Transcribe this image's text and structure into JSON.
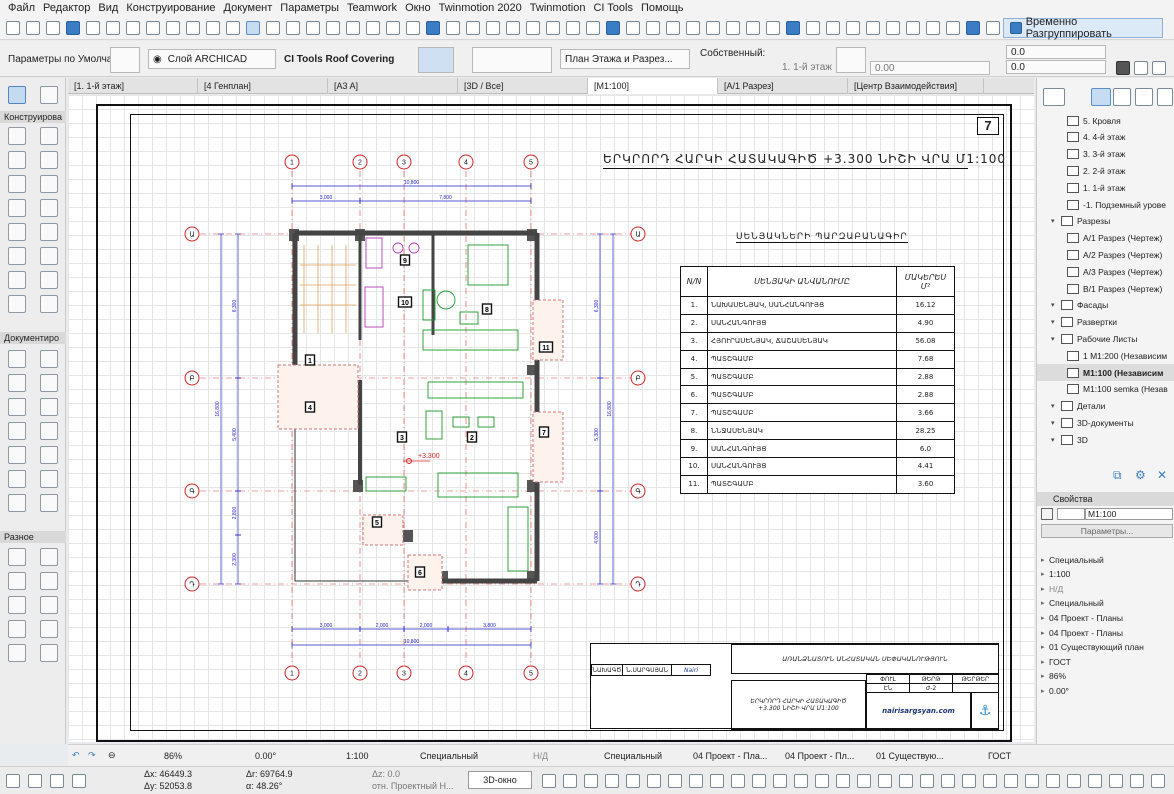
{
  "menu": [
    "Файл",
    "Редактор",
    "Вид",
    "Конструирование",
    "Документ",
    "Параметры",
    "Teamwork",
    "Окно",
    "Twinmotion 2020",
    "Twinmotion",
    "CI Tools",
    "Помощь"
  ],
  "toolbar": {
    "regroup_label": "Временно Разгруппировать"
  },
  "infobox": {
    "defaults": "Параметры по Умолчанию",
    "layer": "Слой ARCHICAD",
    "tool_name": "CI Tools Roof Covering",
    "view_mode": "План Этажа и Разрез...",
    "own_label": "Собственный:",
    "floor": "1. 1-й этаж",
    "val1": "0.0",
    "val2": "0.0",
    "val3": "0.00"
  },
  "tabs": [
    {
      "label": "[1. 1-й этаж]",
      "active": false
    },
    {
      "label": "[4 Генплан]",
      "active": false
    },
    {
      "label": "[A3 A]",
      "active": false
    },
    {
      "label": "[3D / Все]",
      "active": false
    },
    {
      "label": "[M1:100]",
      "active": true
    },
    {
      "label": "[A/1 Разрез]",
      "active": false
    },
    {
      "label": "[Центр Взаимодействия]",
      "active": false
    }
  ],
  "toolbox": {
    "section1": "Конструирова",
    "section2": "Документиро",
    "section3": "Разное"
  },
  "drawing": {
    "sheet_number": "7",
    "title": "ԵՐԿՐՈՐԴ ՀԱՐԿԻ ՀԱՏԱԿԱԳԻԾ  +3.300 ՆԻՇԻ ՎՐԱ   Մ1:100",
    "table_title": "ՍԵՆՅԱԿՆԵՐԻ ՊԱՐԶԱԲԱՆԱԳԻՐ",
    "table_head": [
      "Ν/Ν",
      "ՍԵՆՅԱԿԻ ԱՆՎԱՆՈՒՄԸ",
      "ՄԱԿԵՐԵՍ Մ²"
    ],
    "rows": [
      [
        "1.",
        "ՆԱԽԱՍԵՆՅԱԿ, ՍԱՆՀԱՆԳՈՒՅՑ",
        "16.12"
      ],
      [
        "2.",
        "ՍԱՆՀԱՆԳՈՒՅՑ",
        "4.90"
      ],
      [
        "3.",
        "ՀՅՈՒՐԱՍԵՆՅԱԿ, ՃԱՇԱՍԵՆՅԱԿ",
        "56.08"
      ],
      [
        "4.",
        "ՊԱՏՇԳԱՄԲ",
        "7.68"
      ],
      [
        "5.",
        "ՊԱՏՇԳԱՄԲ",
        "2.88"
      ],
      [
        "6.",
        "ՊԱՏՇԳԱՄԲ",
        "2.88"
      ],
      [
        "7.",
        "ՊԱՏՇԳԱՄԲ",
        "3.66"
      ],
      [
        "8.",
        "ՆՆՋԱՍԵՆՅԱԿ",
        "28.25"
      ],
      [
        "9.",
        "ՍԱՆՀԱՆԳՈՒՅՑ",
        "6.0"
      ],
      [
        "10.",
        "ՍԱՆՀԱՆԳՈՒՅՑ",
        "4.41"
      ],
      [
        "11.",
        "ՊԱՏՇԳԱՄԲ",
        "3.60"
      ]
    ],
    "elevation_mark": "+3.300",
    "dims_top_total": "10,800",
    "dims_top": [
      "3,000",
      "7,800"
    ],
    "dims_bottom": [
      "3,000",
      "2,000",
      "2,000",
      "3,800"
    ],
    "dims_bottom_total": "10,800",
    "dims_left_total": "16,800",
    "dims_left": [
      "6,300",
      "5,400",
      "2,800",
      "2,300"
    ],
    "dims_right": [
      "6,300",
      "5,300",
      "4,000"
    ],
    "axis_labels_top": [
      "1",
      "2",
      "3",
      "4",
      "5"
    ],
    "axis_labels_bottom": [
      "1",
      "2",
      "3",
      "4",
      "5"
    ],
    "axis_labels_left": [
      "Ա",
      "Բ",
      "Գ",
      "Դ"
    ],
    "room_numbers": [
      "1",
      "2",
      "3",
      "4",
      "5",
      "6",
      "7",
      "8",
      "9",
      "10",
      "11"
    ],
    "title_block": {
      "project": "ԱՌԱՆՁՆԱՏՈՒՆ ԱՆՀԱՏԱԿԱՆ ՍԵՓԱԿԱՆՈՒԹՅՈՒՆ",
      "sheet_name": "ԵՐԿՐՈՐԴ ՀԱՐԿԻ ՀԱՏԱԿԱԳԻԾ\n+3.300 ՆԻՇԻ ՎՐԱ  Մ1:100",
      "col_stage": "ՓՈՒԼ",
      "col_sheet": "ԹԵՐԹ",
      "col_sheets": "ԹԵՐԹԵՐ",
      "stage": "ԷՆ",
      "sheet": "Ժ-2",
      "role": "ՆԱԽԱԳԾ",
      "name": "Ն.ՍԱՐԳՍՅԱՆ",
      "signature": "Nairi",
      "site": "nairisargsyan.com"
    }
  },
  "navigator": {
    "items": [
      {
        "label": "5. Кровля",
        "indent": 2,
        "sel": false
      },
      {
        "label": "4. 4-й этаж",
        "indent": 2,
        "sel": false
      },
      {
        "label": "3. 3-й этаж",
        "indent": 2,
        "sel": false
      },
      {
        "label": "2. 2-й этаж",
        "indent": 2,
        "sel": false
      },
      {
        "label": "1. 1-й этаж",
        "indent": 2,
        "sel": false
      },
      {
        "label": "-1. Подземный урове",
        "indent": 2,
        "sel": false
      },
      {
        "label": "Разрезы",
        "indent": 1,
        "sel": false
      },
      {
        "label": "A/1 Разрез (Чертеж)",
        "indent": 2,
        "sel": false
      },
      {
        "label": "A/2 Разрез (Чертеж)",
        "indent": 2,
        "sel": false
      },
      {
        "label": "A/3 Разрез (Чертеж)",
        "indent": 2,
        "sel": false
      },
      {
        "label": "B/1 Разрез (Чертеж)",
        "indent": 2,
        "sel": false
      },
      {
        "label": "Фасады",
        "indent": 1,
        "sel": false
      },
      {
        "label": "Развертки",
        "indent": 1,
        "sel": false
      },
      {
        "label": "Рабочие Листы",
        "indent": 1,
        "sel": false
      },
      {
        "label": "1 M1:200 (Независим",
        "indent": 2,
        "sel": false
      },
      {
        "label": "M1:100 (Независим",
        "indent": 2,
        "sel": true
      },
      {
        "label": "M1:100 semka (Незав",
        "indent": 2,
        "sel": false
      },
      {
        "label": "Детали",
        "indent": 1,
        "sel": false
      },
      {
        "label": "3D-документы",
        "indent": 1,
        "sel": false
      },
      {
        "label": "3D",
        "indent": 1,
        "sel": false
      }
    ]
  },
  "properties": {
    "header": "Свойства",
    "name_value": "M1:100",
    "params_button": "Параметры...",
    "items": [
      "Специальный",
      "1:100",
      "Н/Д",
      "Специальный",
      "04 Проект - Планы",
      "04 Проект - Планы",
      "01 Существующий план",
      "ГОСТ",
      "86%",
      "0.00°"
    ]
  },
  "statusbar": {
    "zoom": "86%",
    "angle": "0.00°",
    "scale": "1:100",
    "special1": "Специальный",
    "nd": "Н/Д",
    "special2": "Специальный",
    "proj1": "04 Проект - Пла...",
    "proj2": "04 Проект - Пл...",
    "exist": "01 Существую...",
    "gost": "ГОСТ"
  },
  "coords": {
    "dx": "Δx: 46449.3",
    "dy": "Δy: 52053.8",
    "dr": "Δr: 69764.9",
    "da": "α: 48.26°",
    "dz": "Δz: 0.0",
    "ref": "отн. Проектный Н...",
    "btn3d": "3D-окно"
  }
}
